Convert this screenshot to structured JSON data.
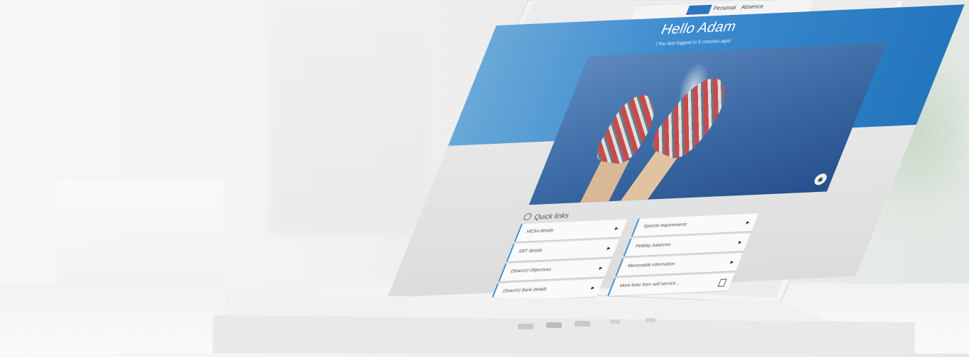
{
  "scene": {
    "description_role": "photo",
    "accent": "#2375bd",
    "brand": "#2f74c3"
  },
  "portal": {
    "nav": [
      "Personal",
      "Absence"
    ],
    "greeting": "Hello Adam",
    "last_login": "(You last logged in 5 minutes ago)",
    "camera_icon": "camera-icon",
    "quick_links": {
      "heading": "Quick links",
      "left": [
        {
          "label": "HESA details"
        },
        {
          "label": "SRT details"
        },
        {
          "label": "(Search) Objectives"
        },
        {
          "label": "(Search) Bank details"
        }
      ],
      "right": [
        {
          "label": "Special requirements"
        },
        {
          "label": "Holiday balances"
        },
        {
          "label": "Memorable information"
        },
        {
          "label": "More links from self service..."
        }
      ]
    }
  }
}
